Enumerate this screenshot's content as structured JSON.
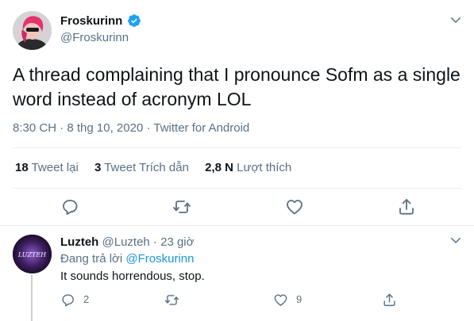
{
  "tweet": {
    "author_name": "Froskurinn",
    "author_handle": "@Froskurinn",
    "verified": true,
    "text": "A thread complaining that I pronounce Sofm as a single word instead of acronym LOL",
    "time": "8:30 CH",
    "separator": " · ",
    "date": "8 thg 10, 2020",
    "source": "Twitter for Android",
    "stats": {
      "retweets_count": "18",
      "retweets_label": "Tweet lại",
      "quotes_count": "3",
      "quotes_label": "Tweet Trích dẫn",
      "likes_count": "2,8 N",
      "likes_label": "Lượt thích"
    },
    "actions": [
      "reply-icon",
      "retweet-icon",
      "like-icon",
      "share-icon"
    ]
  },
  "reply": {
    "author_name": "Luzteh",
    "author_handle": "@Luzteh",
    "separator": " · ",
    "time": "23 giờ",
    "replying_to_label": "Đang trả lời ",
    "replying_to_handle": "@Froskurinn",
    "text": "It sounds horrendous, stop.",
    "avatar_text": "LUZTEH",
    "reply_count": "2",
    "retweet_count": "",
    "like_count": "9"
  },
  "colors": {
    "text": "#0f1419",
    "secondary": "#5b7083",
    "link": "#1b95e0",
    "divider": "#ebeef0",
    "verified": "#1da1f2"
  }
}
